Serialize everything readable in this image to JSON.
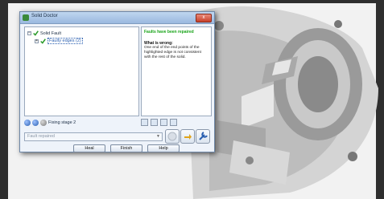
{
  "window": {
    "title": "Solid Doctor",
    "close_label": "x"
  },
  "tree": {
    "root_label": "Solid Fault",
    "child_label": "Faulty edges (2)",
    "root_expander": "−",
    "child_expander": "+"
  },
  "info_panel": {
    "heading": "Faults have been repaired",
    "subheading": "What is wrong:",
    "description": "One end of the end points of the highlighted edge is not consistent with the rest of the solid."
  },
  "status": {
    "stage": "Fixing stage 2"
  },
  "combo": {
    "value": "Fault repaired",
    "arrow": "▼"
  },
  "buttons": {
    "heal": "Heal",
    "finish": "Finish",
    "help": "Help"
  },
  "colors": {
    "accent": "#2a5fb0",
    "success": "#17a317"
  }
}
